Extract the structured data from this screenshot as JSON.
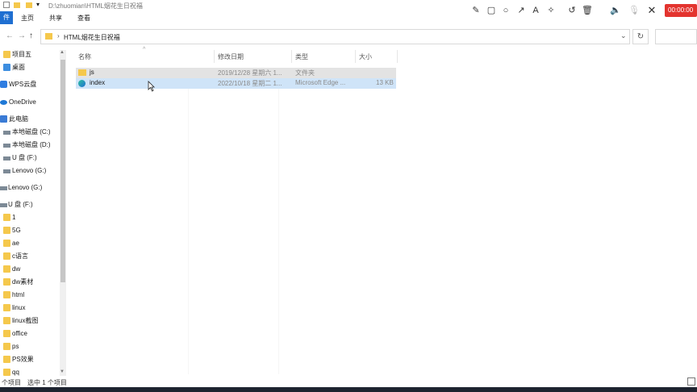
{
  "titlebar": {
    "path": "D:\\zhuomian\\HTML烟花生日祝福"
  },
  "ribbon": {
    "file_tab": "件",
    "tabs": [
      "主页",
      "共享",
      "查看"
    ]
  },
  "recorder": {
    "icons": [
      "pencil-icon",
      "rectangle-icon",
      "circle-icon",
      "arrow-icon",
      "text-icon",
      "magic-wand-icon",
      "undo-icon",
      "trash-icon",
      "speaker-icon",
      "microphone-off-icon",
      "close-icon"
    ],
    "time": "00:00:00",
    "accent_color": "#e3342f"
  },
  "address": {
    "crumb": "HTML烟花生日祝福"
  },
  "sidebar": {
    "items": [
      {
        "label": "项目五",
        "icon": "folder-icon"
      },
      {
        "label": "桌面",
        "icon": "folder-icon"
      },
      {
        "label": "WPS云盘",
        "icon": "wps-cloud-icon"
      },
      {
        "label": "OneDrive",
        "icon": "cloud-icon"
      },
      {
        "label": "此电脑",
        "icon": "computer-icon"
      },
      {
        "label": "本地磁盘 (C:)",
        "icon": "drive-icon"
      },
      {
        "label": "本地磁盘 (D:)",
        "icon": "drive-icon"
      },
      {
        "label": "U 盘 (F:)",
        "icon": "drive-icon"
      },
      {
        "label": "Lenovo (G:)",
        "icon": "drive-icon"
      },
      {
        "label": "Lenovo (G:)",
        "icon": "drive-icon"
      },
      {
        "label": "U 盘 (F:)",
        "icon": "drive-icon"
      },
      {
        "label": "1",
        "icon": "folder-icon"
      },
      {
        "label": "5G",
        "icon": "folder-icon"
      },
      {
        "label": "ae",
        "icon": "folder-icon"
      },
      {
        "label": "c语言",
        "icon": "folder-icon"
      },
      {
        "label": "dw",
        "icon": "folder-icon"
      },
      {
        "label": "dw素材",
        "icon": "folder-icon"
      },
      {
        "label": "html",
        "icon": "folder-icon"
      },
      {
        "label": "linux",
        "icon": "folder-icon"
      },
      {
        "label": "linux截图",
        "icon": "folder-icon"
      },
      {
        "label": "office",
        "icon": "folder-icon"
      },
      {
        "label": "ps",
        "icon": "folder-icon"
      },
      {
        "label": "PS效果",
        "icon": "folder-icon"
      },
      {
        "label": "qq",
        "icon": "folder-icon"
      }
    ]
  },
  "list": {
    "headers": {
      "name": "名称",
      "date": "修改日期",
      "type": "类型",
      "size": "大小"
    },
    "rows": [
      {
        "name": "js",
        "date": "2019/12/28 星期六 1...",
        "type": "文件夹",
        "size": "",
        "icon": "folder-icon"
      },
      {
        "name": "index",
        "date": "2022/10/18 星期二 1...",
        "type": "Microsoft Edge ...",
        "size": "13 KB",
        "icon": "edge-icon"
      }
    ]
  },
  "status": {
    "count": "个项目",
    "selected": "选中 1 个项目"
  }
}
